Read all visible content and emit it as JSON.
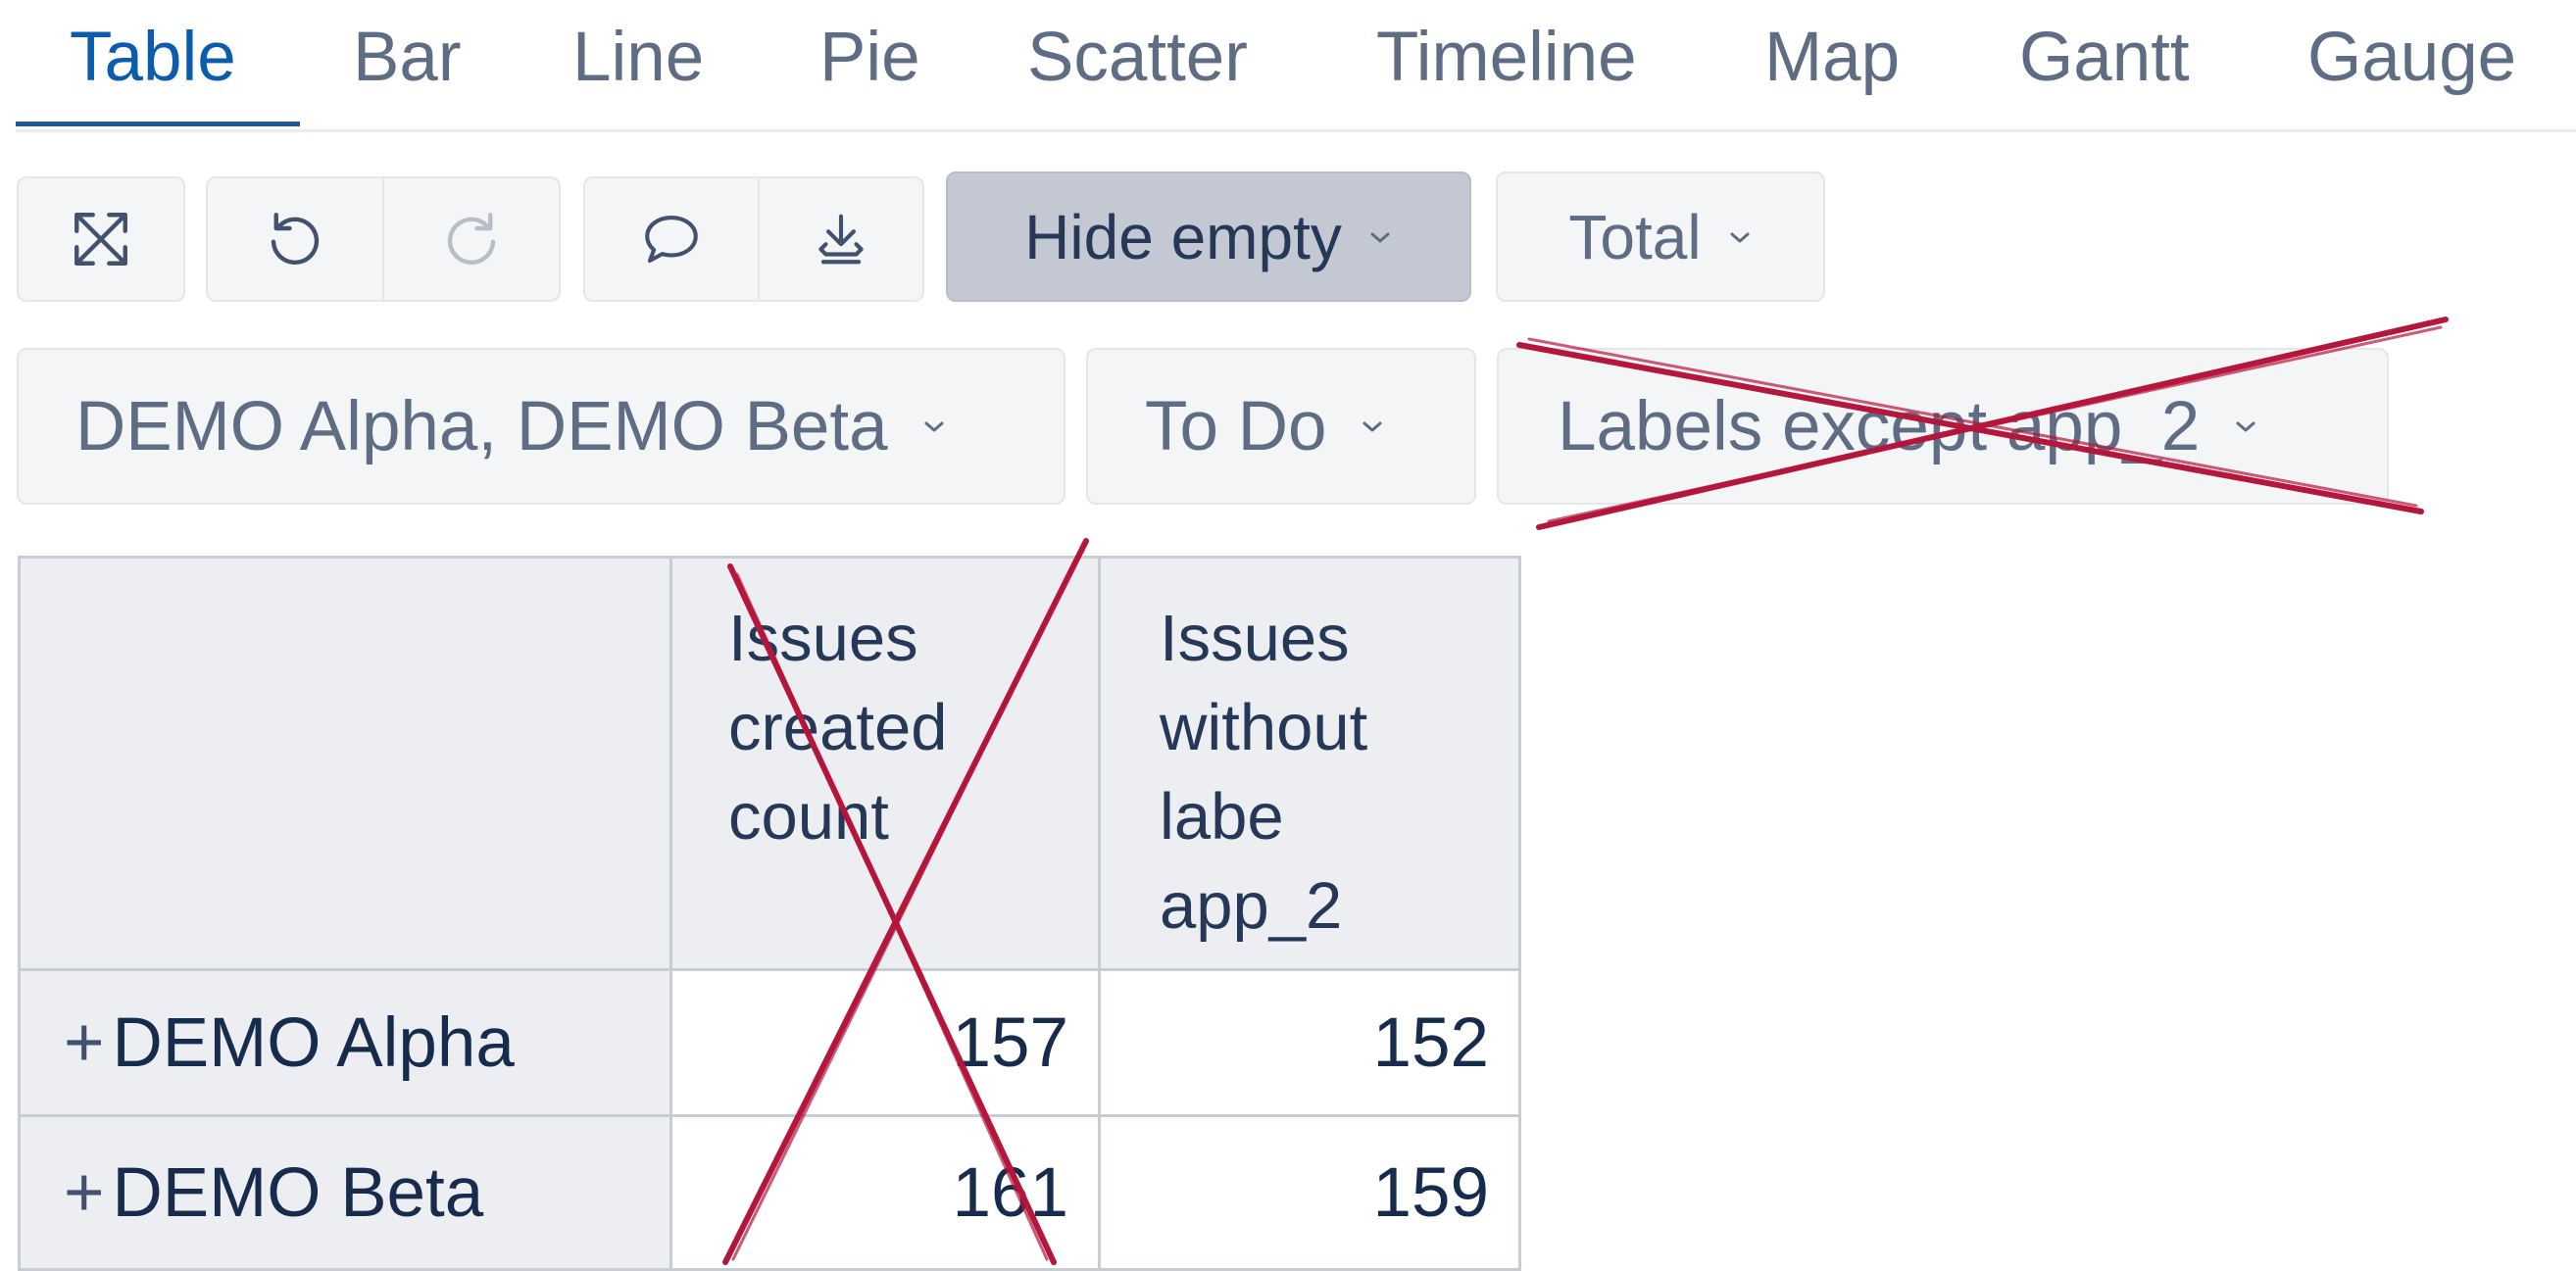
{
  "tabs": [
    {
      "label": "Table",
      "active": true
    },
    {
      "label": "Bar"
    },
    {
      "label": "Line"
    },
    {
      "label": "Pie"
    },
    {
      "label": "Scatter"
    },
    {
      "label": "Timeline"
    },
    {
      "label": "Map"
    },
    {
      "label": "Gantt"
    },
    {
      "label": "Gauge"
    }
  ],
  "toolbar": {
    "icons": [
      "fullscreen-icon",
      "undo-icon",
      "redo-icon",
      "comment-icon",
      "download-icon"
    ],
    "hide_empty_label": "Hide empty",
    "total_label": "Total"
  },
  "filters": {
    "projects_label": "DEMO Alpha, DEMO Beta",
    "status_label": "To Do",
    "labels_label": "Labels except app_2"
  },
  "table": {
    "columns": [
      "Issues created count",
      "Issues without labe app_2"
    ],
    "rows": [
      {
        "label": "DEMO Alpha",
        "values": [
          "157",
          "152"
        ]
      },
      {
        "label": "DEMO Beta",
        "values": [
          "161",
          "159"
        ]
      }
    ]
  },
  "colors": {
    "accent": "#0c5cad",
    "cross_out": "#b5163b"
  }
}
